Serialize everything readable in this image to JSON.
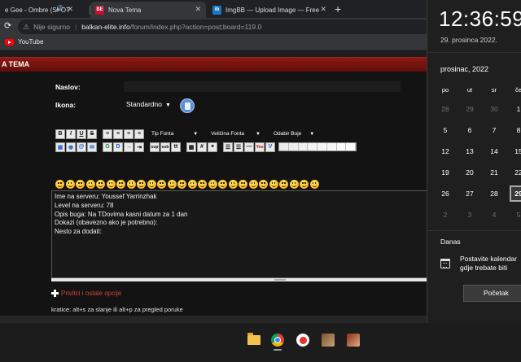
{
  "browser": {
    "tabs": [
      {
        "label": "e Gee - Ombre (SPOT",
        "favicon_color": "#202124",
        "active": false,
        "playing": true
      },
      {
        "label": "Nova Tema",
        "favicon_text": "BE",
        "favicon_color": "#c8102e",
        "active": true
      },
      {
        "label": "ImgBB — Upload Image — Free",
        "favicon_text": "ib",
        "favicon_color": "#1a78c2",
        "active": false
      }
    ],
    "security_label": "Nije sigurno",
    "url_domain": "balkan-elite.info",
    "url_path": "/forum/index.php?action=post;board=119.0",
    "bookmark": "YouTube"
  },
  "forum": {
    "section_title": "A TEMA",
    "subject_label": "Naslov:",
    "subject_value": "",
    "icon_label": "Ikona:",
    "icon_value": "Standardno",
    "toolbar_selects": [
      "Tip Fonta",
      "Veličina Fonta",
      "Odabir Boje"
    ],
    "toolbar_row1": [
      "B",
      "I",
      "U",
      "S"
    ],
    "smiley_count": 26,
    "message_lines": [
      "Ime na serveru: Youssef Yarrinzhak",
      "Level na serveru: 78",
      "Opis buga: Na TDovima kasni datum za 1 dan",
      "Dokazi (obavezno ako je potrebno):",
      "Nesto za dodati:"
    ],
    "more_options": "Privitci i ostale opcije",
    "shortcuts": "kratice: alt+s za slanje ili alt+p za pregled poruke"
  },
  "clock": {
    "time": "12:36:59",
    "date": "29. prosinca 2022.",
    "month": "prosinac, 2022",
    "weekdays": [
      "po",
      "ut",
      "sr",
      "če"
    ],
    "weeks": [
      [
        "28",
        "29",
        "30",
        "1"
      ],
      [
        "5",
        "6",
        "7",
        "8"
      ],
      [
        "12",
        "13",
        "14",
        "15"
      ],
      [
        "19",
        "20",
        "21",
        "22"
      ],
      [
        "26",
        "27",
        "28",
        "29"
      ],
      [
        "2",
        "3",
        "4",
        "5"
      ]
    ],
    "today": "29",
    "today_label": "Danas",
    "note_lines": [
      "Postavite kalendar",
      "gdje trebate biti"
    ],
    "start_button": "Početak"
  },
  "colors": {
    "section_bar": "#7a1510",
    "more_options_link": "#d0443a",
    "page_bg": "#131313"
  }
}
